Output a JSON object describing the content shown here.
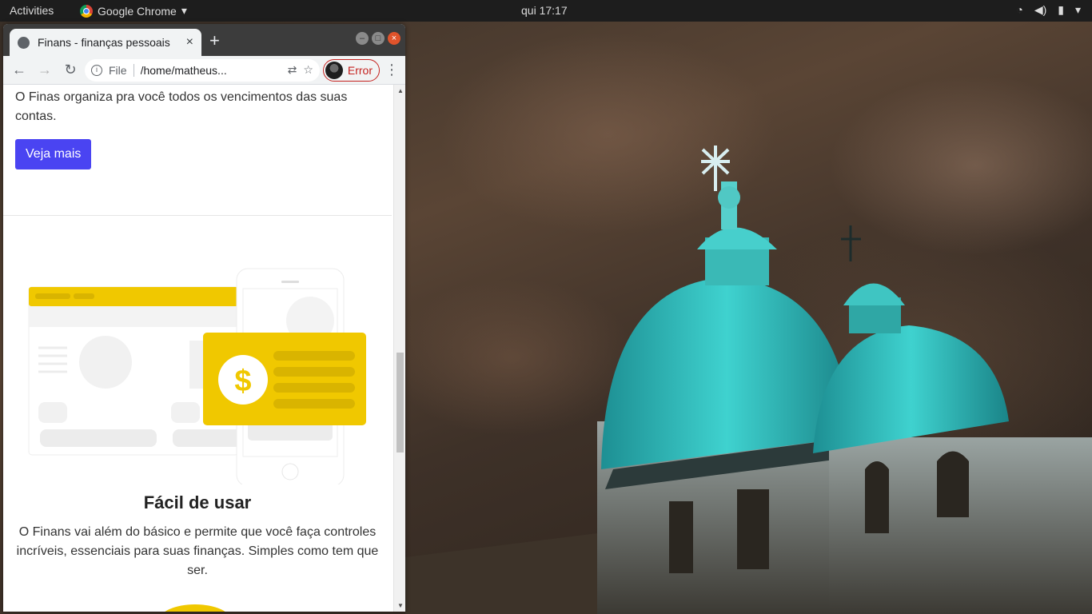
{
  "topbar": {
    "activities": "Activities",
    "app_name": "Google Chrome",
    "app_menu_icon": "▾",
    "clock": "qui 17:17",
    "icons": [
      "wifi-icon",
      "volume-icon",
      "battery-icon",
      "power-menu-icon"
    ]
  },
  "browser": {
    "tab_title": "Finans - finanças pessoais",
    "tab_close": "×",
    "new_tab": "+",
    "url_scheme": "File",
    "url": "/home/matheus...",
    "error_label": "Error",
    "back_icon": "←",
    "forward_icon": "→",
    "reload_icon": "↻",
    "info_icon": "i",
    "translate_icon": "⇄",
    "star_icon": "☆",
    "menu_icon": "⋮",
    "win_min": "–",
    "win_max": "□",
    "win_close": "×",
    "scroll_up": "▲",
    "scroll_down": "▼"
  },
  "page": {
    "intro_text": "O Finas organiza pra você todos os vencimentos das suas contas.",
    "cta_label": "Veja mais",
    "feature_title": "Fácil de usar",
    "feature_desc": "O Finans vai além do básico e permite que você faça controles incríveis, essenciais para suas finanças. Simples como tem que ser.",
    "currency_symbol": "$"
  },
  "colors": {
    "accent": "#4a44f2",
    "illustration_yellow": "#f0c800",
    "dome_teal": "#2fb8b8"
  }
}
